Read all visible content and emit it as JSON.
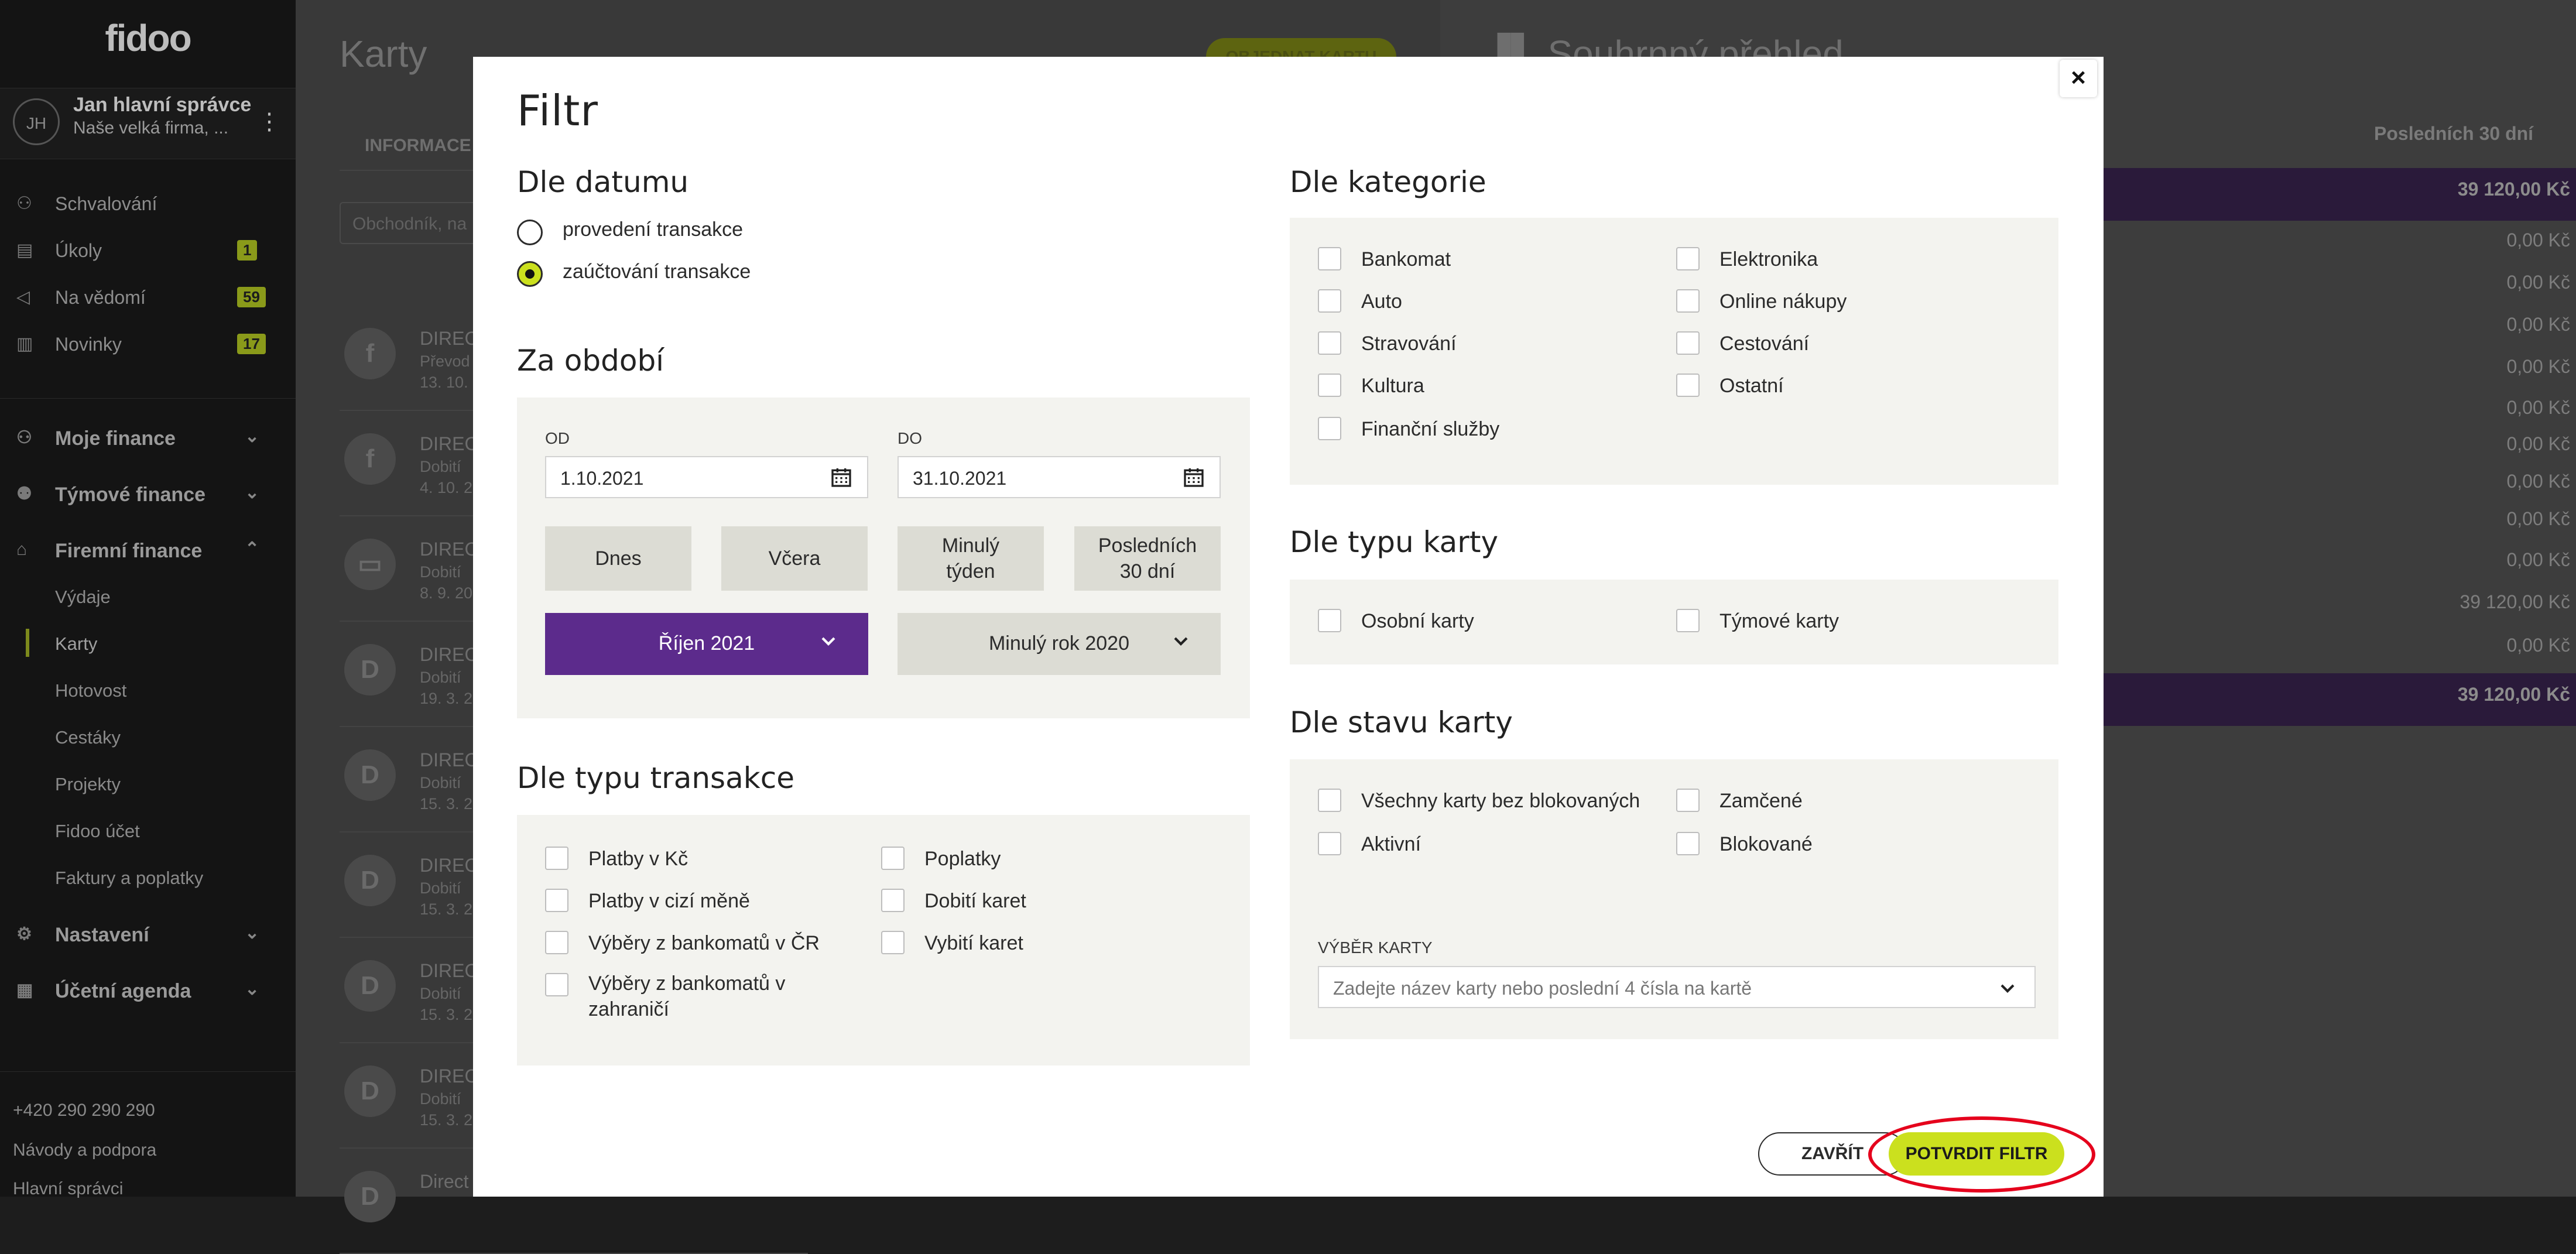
{
  "sidebar": {
    "logo": "fidoo",
    "user": {
      "initials": "JH",
      "name": "Jan hlavní správce",
      "company": "Naše velká firma, ...",
      "menu_icon": "more-vertical-icon"
    },
    "nav": [
      {
        "label": "Schvalování",
        "icon": "user-check-icon",
        "badge": ""
      },
      {
        "label": "Úkoly",
        "icon": "clipboard-icon",
        "badge": "1"
      },
      {
        "label": "Na vědomí",
        "icon": "megaphone-icon",
        "badge": "59"
      },
      {
        "label": "Novinky",
        "icon": "newspaper-icon",
        "badge": "17"
      }
    ],
    "groups": [
      {
        "label": "Moje finance",
        "icon": "user-icon"
      },
      {
        "label": "Týmové finance",
        "icon": "team-icon"
      },
      {
        "label": "Firemní finance",
        "icon": "company-icon"
      }
    ],
    "company_items": [
      "Výdaje",
      "Karty",
      "Hotovost",
      "Cestáky",
      "Projekty",
      "Fidoo účet",
      "Faktury a poplatky"
    ],
    "active_item": "Karty",
    "bottom_groups": [
      {
        "label": "Nastavení",
        "icon": "gear-icon"
      },
      {
        "label": "Účetní agenda",
        "icon": "ledger-icon"
      }
    ],
    "footer": {
      "phone": "+420 290 290 290",
      "help": "Návody a podpora",
      "role": "Hlavní správci"
    }
  },
  "background": {
    "title": "Karty",
    "order_button": "OBJEDNAT KARTU",
    "tab_info": "INFORMACE",
    "search_placeholder": "Obchodník, na",
    "rows": [
      {
        "icon": "fidoo",
        "t1": "DIRECT",
        "t2": "Převod",
        "t3": "13. 10."
      },
      {
        "icon": "fidoo",
        "t1": "DIRECT",
        "t2": "Dobití",
        "t3": "4. 10. 2"
      },
      {
        "icon": "card",
        "t1": "DIRECT",
        "t2": "Dobití",
        "t3": "8. 9. 20"
      },
      {
        "icon": "D",
        "t1": "DIRECT",
        "t2": "Dobití",
        "t3": "19. 3. 2"
      },
      {
        "icon": "D",
        "t1": "DIRECT",
        "t2": "Dobití",
        "t3": "15. 3. 2"
      },
      {
        "icon": "D",
        "t1": "DIRECT",
        "t2": "Dobití",
        "t3": "15. 3. 2"
      },
      {
        "icon": "D",
        "t1": "DIRECT",
        "t2": "Dobití",
        "t3": "15. 3. 2"
      },
      {
        "icon": "D",
        "t1": "DIRECT",
        "t2": "Dobití",
        "t3": "15. 3. 2"
      },
      {
        "icon": "D",
        "t1": "Direct",
        "t2": "",
        "t3": ""
      }
    ],
    "overview_title": "Souhrnný přehled",
    "overview_period": "Posledních 30 dní",
    "overview_values": [
      {
        "value": "39 120,00 Kč",
        "highlight": true
      },
      {
        "value": "0,00 Kč",
        "highlight": false
      },
      {
        "value": "0,00 Kč",
        "highlight": false
      },
      {
        "value": "0,00 Kč",
        "highlight": false
      },
      {
        "value": "0,00 Kč",
        "highlight": false
      },
      {
        "value": "0,00 Kč",
        "highlight": false
      },
      {
        "value": "0,00 Kč",
        "highlight": false
      },
      {
        "value": "0,00 Kč",
        "highlight": false
      },
      {
        "value": "0,00 Kč",
        "highlight": false
      },
      {
        "value": "0,00 Kč",
        "highlight": false
      },
      {
        "value": "39 120,00 Kč",
        "highlight": false
      },
      {
        "value": "0,00 Kč",
        "highlight": false
      },
      {
        "value": "39 120,00 Kč",
        "highlight": true
      }
    ]
  },
  "modal": {
    "title": "Filtr",
    "close_symbol": "×",
    "by_date": {
      "heading": "Dle datumu",
      "options": [
        {
          "label": "provedení transakce",
          "checked": false
        },
        {
          "label": "zaúčtování transakce",
          "checked": true
        }
      ]
    },
    "period": {
      "heading": "Za období",
      "from_label": "OD",
      "from_value": "1.10.2021",
      "to_label": "DO",
      "to_value": "31.10.2021",
      "quick_buttons": [
        "Dnes",
        "Včera",
        "Minulý týden",
        "Posledních 30 dní"
      ],
      "month_select": "Říjen 2021",
      "year_select": "Minulý rok 2020"
    },
    "by_transaction_type": {
      "heading": "Dle typu transakce",
      "left": [
        "Platby v Kč",
        "Platby v cizí měně",
        "Výběry z bankomatů v ČR",
        "Výběry z bankomatů v zahraničí"
      ],
      "right": [
        "Poplatky",
        "Dobití karet",
        "Vybití karet"
      ]
    },
    "by_category": {
      "heading": "Dle kategorie",
      "left": [
        "Bankomat",
        "Auto",
        "Stravování",
        "Kultura",
        "Finanční služby"
      ],
      "right": [
        "Elektronika",
        "Online nákupy",
        "Cestování",
        "Ostatní"
      ]
    },
    "by_card_type": {
      "heading": "Dle typu karty",
      "left": [
        "Osobní karty"
      ],
      "right": [
        "Týmové karty"
      ]
    },
    "by_card_state": {
      "heading": "Dle stavu karty",
      "left": [
        "Všechny karty bez blokovaných",
        "Aktivní"
      ],
      "right": [
        "Zamčené",
        "Blokované"
      ],
      "card_select_label": "VÝBĚR KARTY",
      "card_select_placeholder": "Zadejte název karty nebo poslední 4 čísla na kartě"
    },
    "buttons": {
      "close": "ZAVŘÍT",
      "confirm": "POTVRDIT FILTR"
    },
    "highlight_color": "#e5001c",
    "accent_color": "#cbe01e",
    "primary_color": "#5c2b8c"
  }
}
